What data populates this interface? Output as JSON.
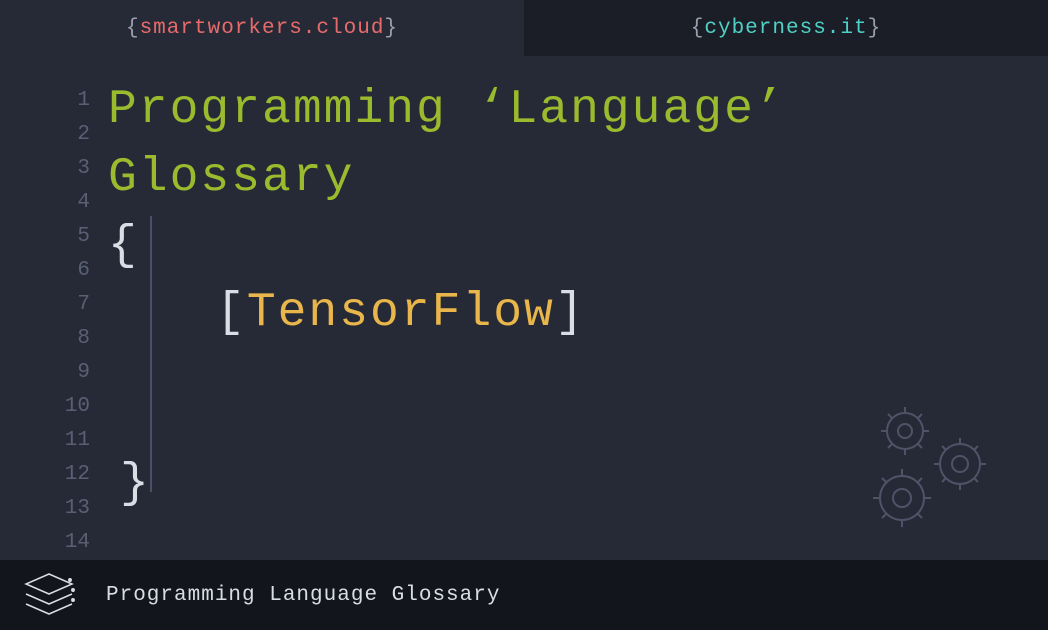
{
  "tabs": {
    "left_site": "smartworkers.cloud",
    "right_site": "cyberness.it"
  },
  "editor": {
    "line_numbers": [
      "1",
      "2",
      "3",
      "4",
      "5",
      "6",
      "7",
      "8",
      "9",
      "10",
      "11",
      "12",
      "13",
      "14"
    ],
    "title": "Programming ‘Language’ Glossary",
    "open_brace": "{",
    "close_brace": "}",
    "term": "TensorFlow"
  },
  "footer": {
    "label": "Programming Language Glossary"
  },
  "colors": {
    "background": "#262a36",
    "footer_bg": "#13151d",
    "accent_green": "#9abb2d",
    "accent_orange": "#e8b64a",
    "accent_red": "#e86b6b",
    "accent_teal": "#4fd1c5"
  }
}
